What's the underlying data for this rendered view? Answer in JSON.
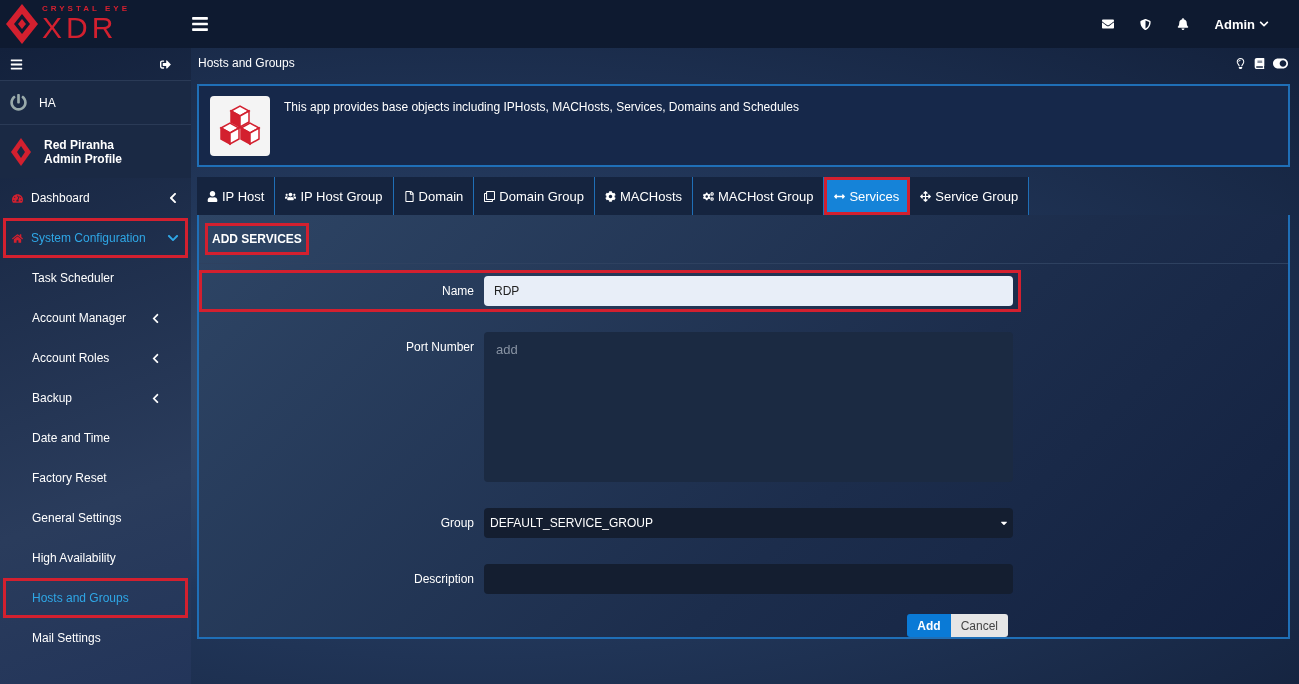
{
  "logo": {
    "top": "CRYSTAL EYE",
    "main": "XDR"
  },
  "topbar": {
    "user": "Admin"
  },
  "sidebar": {
    "status": "HA",
    "profile": {
      "name": "Red Piranha",
      "role": "Admin Profile"
    },
    "nav": [
      {
        "label": "Dashboard",
        "expanded": false,
        "selected": false,
        "highlighted": false
      },
      {
        "label": "System Configuration",
        "expanded": true,
        "selected": true,
        "highlighted": true,
        "children": [
          {
            "label": "Task Scheduler",
            "kind": "link",
            "selected": false,
            "highlighted": false
          },
          {
            "label": "Account Manager",
            "kind": "submenu",
            "selected": false,
            "highlighted": false
          },
          {
            "label": "Account Roles",
            "kind": "submenu",
            "selected": false,
            "highlighted": false
          },
          {
            "label": "Backup",
            "kind": "submenu",
            "selected": false,
            "highlighted": false
          },
          {
            "label": "Date and Time",
            "kind": "link",
            "selected": false,
            "highlighted": false
          },
          {
            "label": "Factory Reset",
            "kind": "link",
            "selected": false,
            "highlighted": false
          },
          {
            "label": "General Settings",
            "kind": "link",
            "selected": false,
            "highlighted": false
          },
          {
            "label": "High Availability",
            "kind": "link",
            "selected": false,
            "highlighted": false
          },
          {
            "label": "Hosts and Groups",
            "kind": "link",
            "selected": true,
            "highlighted": true
          },
          {
            "label": "Mail Settings",
            "kind": "link",
            "selected": false,
            "highlighted": false
          }
        ]
      }
    ]
  },
  "page": {
    "title": "Hosts and Groups",
    "description": "This app provides base objects including IPHosts, MACHosts, Services, Domains and Schedules"
  },
  "tabs": [
    {
      "label": "IP Host",
      "selected": false,
      "highlighted": false
    },
    {
      "label": "IP Host Group",
      "selected": false,
      "highlighted": false
    },
    {
      "label": "Domain",
      "selected": false,
      "highlighted": false
    },
    {
      "label": "Domain Group",
      "selected": false,
      "highlighted": false
    },
    {
      "label": "MACHosts",
      "selected": false,
      "highlighted": false
    },
    {
      "label": "MACHost Group",
      "selected": false,
      "highlighted": false
    },
    {
      "label": "Services",
      "selected": true,
      "highlighted": true
    },
    {
      "label": "Service Group",
      "selected": false,
      "highlighted": false
    }
  ],
  "form": {
    "title": "ADD SERVICES",
    "title_highlighted": true,
    "fields": [
      {
        "label": "Name",
        "kind": "text",
        "value": "RDP",
        "highlighted": true
      },
      {
        "label": "Port Number",
        "kind": "textarea",
        "placeholder": "add",
        "highlighted": false
      },
      {
        "label": "Group",
        "kind": "select",
        "value": "DEFAULT_SERVICE_GROUP",
        "highlighted": false
      },
      {
        "label": "Description",
        "kind": "text",
        "highlighted": false
      }
    ],
    "buttons": [
      {
        "label": "Add",
        "kind": "primary"
      },
      {
        "label": "Cancel",
        "kind": "default"
      }
    ]
  }
}
